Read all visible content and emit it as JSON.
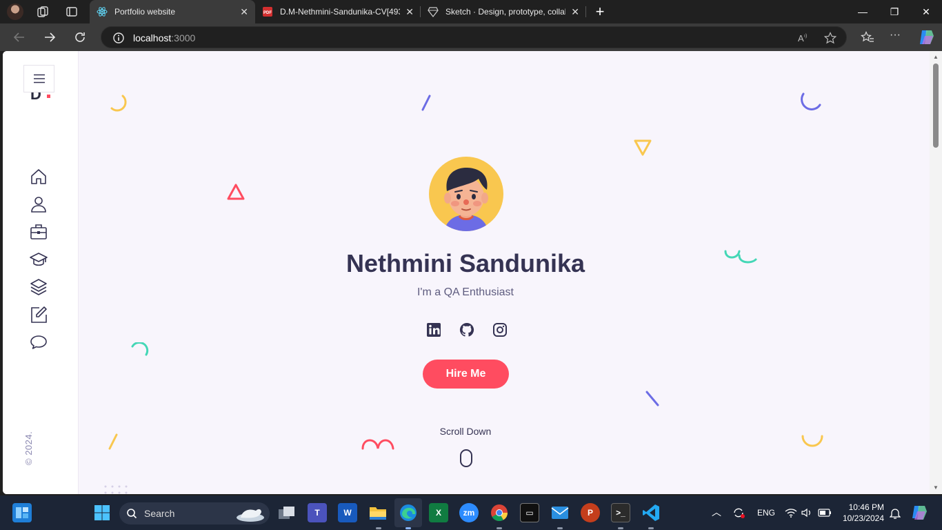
{
  "browser": {
    "tabs": [
      {
        "title": "Portfolio website",
        "active": true,
        "icon": "react-icon"
      },
      {
        "title": "D.M-Nethmini-Sandunika-CV[493",
        "active": false,
        "icon": "pdf-icon"
      },
      {
        "title": "Sketch · Design, prototype, collab",
        "active": false,
        "icon": "sketch-icon"
      }
    ],
    "url_host": "localhost",
    "url_port": ":3000"
  },
  "sidebar": {
    "logo": "D",
    "nav_icons": [
      "home-icon",
      "user-icon",
      "briefcase-icon",
      "graduation-cap-icon",
      "layers-icon",
      "edit-icon",
      "chat-icon"
    ],
    "copyright": "© 2024."
  },
  "hero": {
    "name": "Nethmini Sandunika",
    "tagline": "I'm a QA Enthusiast",
    "socials": [
      "linkedin-icon",
      "github-icon",
      "instagram-icon"
    ],
    "cta": "Hire Me",
    "scroll_label": "Scroll Down"
  },
  "colors": {
    "accent": "#ff4c60",
    "heading": "#353353",
    "page_bg": "#f8f5fc",
    "yellow": "#f9c74f",
    "purple": "#6c6ce5",
    "teal": "#44d7b6"
  },
  "taskbar": {
    "search_placeholder": "Search",
    "language": "ENG",
    "time": "10:46 PM",
    "date": "10/23/2024"
  }
}
